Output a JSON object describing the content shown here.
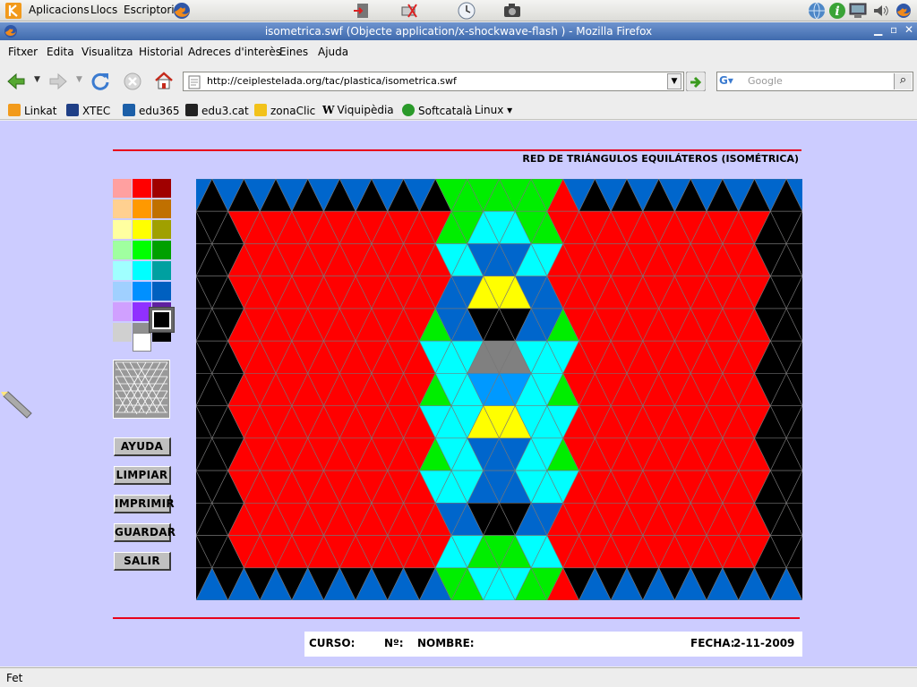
{
  "taskbar": {
    "menus": [
      "Aplicacions",
      "Llocs",
      "Escriptori"
    ],
    "icons": [
      "k-logo-icon",
      "firefox-icon",
      "logout-icon",
      "screenshot-cut-icon",
      "clock-icon",
      "camera-icon",
      "network-icon",
      "info-icon",
      "monitor-icon",
      "volume-icon",
      "firefox-tray-icon"
    ]
  },
  "window": {
    "title": "isometrica.swf (Objecte application/x-shockwave-flash ) - Mozilla Firefox"
  },
  "menubar": [
    "Fitxer",
    "Edita",
    "Visualitza",
    "Historial",
    "Adreces d'interès",
    "Eines",
    "Ajuda"
  ],
  "navigation": {
    "url": "http://ceiplestelada.org/tac/plastica/isometrica.swf",
    "search_placeholder": "Google"
  },
  "bookmarks": [
    {
      "label": "Linkat",
      "color": "#f29a1b"
    },
    {
      "label": "XTEC",
      "color": "#1f3f86"
    },
    {
      "label": "edu365",
      "color": "#1c5fa8"
    },
    {
      "label": "edu3.cat",
      "color": "#222222"
    },
    {
      "label": "zonaClic",
      "color": "#f2c21a"
    },
    {
      "label": "Viquipèdia",
      "color": "#ffffff"
    },
    {
      "label": "Softcatalà",
      "color": "#2a9a2a"
    },
    {
      "label": "Linux ▾",
      "color": "#ededed"
    }
  ],
  "flash_app": {
    "heading": "RED DE TRIÁNGULOS EQUILÁTEROS (ISOMÉTRICA)",
    "buttons": [
      "AYUDA",
      "LIMPIAR",
      "IMPRIMIR",
      "GUARDAR",
      "SALIR"
    ],
    "palette": [
      [
        "#ffa0a0",
        "#ff0000",
        "#a00000"
      ],
      [
        "#ffd090",
        "#ff9900",
        "#c07000"
      ],
      [
        "#ffffa0",
        "#ffff00",
        "#a0a000"
      ],
      [
        "#a0ffa0",
        "#00ff00",
        "#00a000"
      ],
      [
        "#a0ffff",
        "#00ffff",
        "#00a0a0"
      ],
      [
        "#a0d0ff",
        "#0090ff",
        "#0060c0"
      ],
      [
        "#d0a0ff",
        "#9030ff",
        "#6020a0"
      ],
      [
        "#d0d0d0",
        "#909090",
        "#000000"
      ]
    ],
    "selected_color": "#000000",
    "extra_color": "#ffffff",
    "info": {
      "curso_label": "CURSO:",
      "numero_label": "Nº:",
      "nombre_label": "NOMBRE:",
      "fecha_label": "FECHA:",
      "fecha_value": "2-11-2009"
    }
  },
  "status": {
    "text": "Fet"
  }
}
